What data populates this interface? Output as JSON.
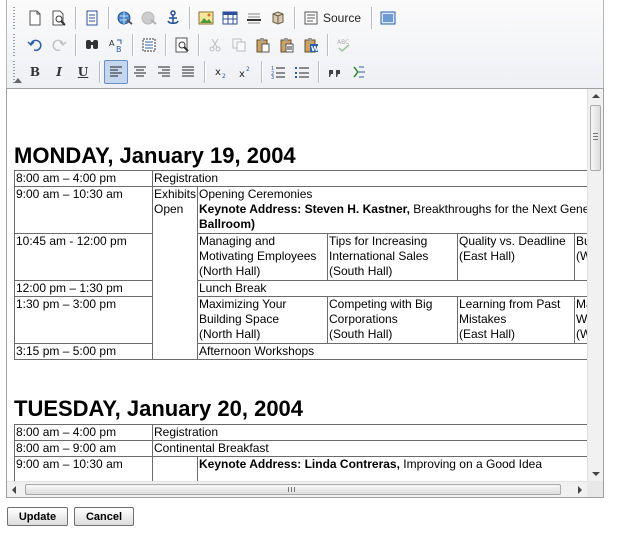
{
  "toolbar": {
    "source_label": "Source",
    "row1": [
      "new-page-icon",
      "preview-icon",
      "template-icon",
      "link-icon",
      "unlink-icon",
      "anchor-icon",
      "image-icon",
      "table-icon",
      "horizontal-rule-icon",
      "special-char-icon"
    ],
    "row2": [
      "undo-icon",
      "redo-icon",
      "find-icon",
      "replace-icon",
      "select-all-icon",
      "zoom-page-icon",
      "cut-icon",
      "copy-icon",
      "paste-icon",
      "paste-text-icon",
      "paste-word-icon",
      "spellcheck-icon"
    ],
    "format": {
      "bold": "B",
      "italic": "I",
      "underline": "U"
    },
    "colors": {
      "accent": "#c4d7ef",
      "border": "#6a8fc7"
    }
  },
  "document": {
    "monday": {
      "heading": "MONDAY, January 19, 2004",
      "rows": [
        {
          "time": "8:00 am – 4:00 pm",
          "text": "Registration"
        },
        {
          "time": "9:00 am – 10:30 am",
          "line1": "Opening Ceremonies",
          "keynote": "Keynote Address: Steven H. Kastner,",
          "topic": " Breakthroughs for the Next Gene",
          "room": "Ballroom)"
        },
        {
          "time": "10:45 am - 12:00 pm",
          "sessions": [
            {
              "t1": "Managing and",
              "t2": "Motivating Employees",
              "t3": "(North Hall)"
            },
            {
              "t1": "Tips for Increasing",
              "t2": "International Sales",
              "t3": "(South Hall)"
            },
            {
              "t1": "Quality vs. Deadline",
              "t2": "(East Hall)",
              "t3": ""
            },
            {
              "t1": "Bu",
              "t2": "(W",
              "t3": ""
            }
          ]
        },
        {
          "time": "12:00 pm – 1:30 pm",
          "text": "Lunch Break"
        },
        {
          "time": "1:30 pm – 3:00 pm",
          "sessions": [
            {
              "t1": "Maximizing Your",
              "t2": "Building Space",
              "t3": "(North Hall)"
            },
            {
              "t1": "Competing with Big",
              "t2": "Corporations",
              "t3": "(South Hall)"
            },
            {
              "t1": "Learning from Past",
              "t2": "Mistakes",
              "t3": "(East Hall)"
            },
            {
              "t1": "Ma",
              "t2": "W",
              "t3": "(W"
            }
          ]
        },
        {
          "time": "3:15 pm – 5:00 pm",
          "text": "Afternoon Workshops"
        }
      ],
      "exhibits": "Exhibits Open"
    },
    "tuesday": {
      "heading": "TUESDAY, January 20, 2004",
      "rows": [
        {
          "time": "8:00 am – 4:00 pm",
          "text": "Registration"
        },
        {
          "time": "8:00 am – 9:00 am",
          "text": "Continental Breakfast"
        },
        {
          "time": "9:00 am – 10:30 am",
          "keynote": "Keynote Address: Linda Contreras,",
          "topic": " Improving on a Good Idea"
        }
      ]
    }
  },
  "buttons": {
    "update": "Update",
    "cancel": "Cancel"
  }
}
